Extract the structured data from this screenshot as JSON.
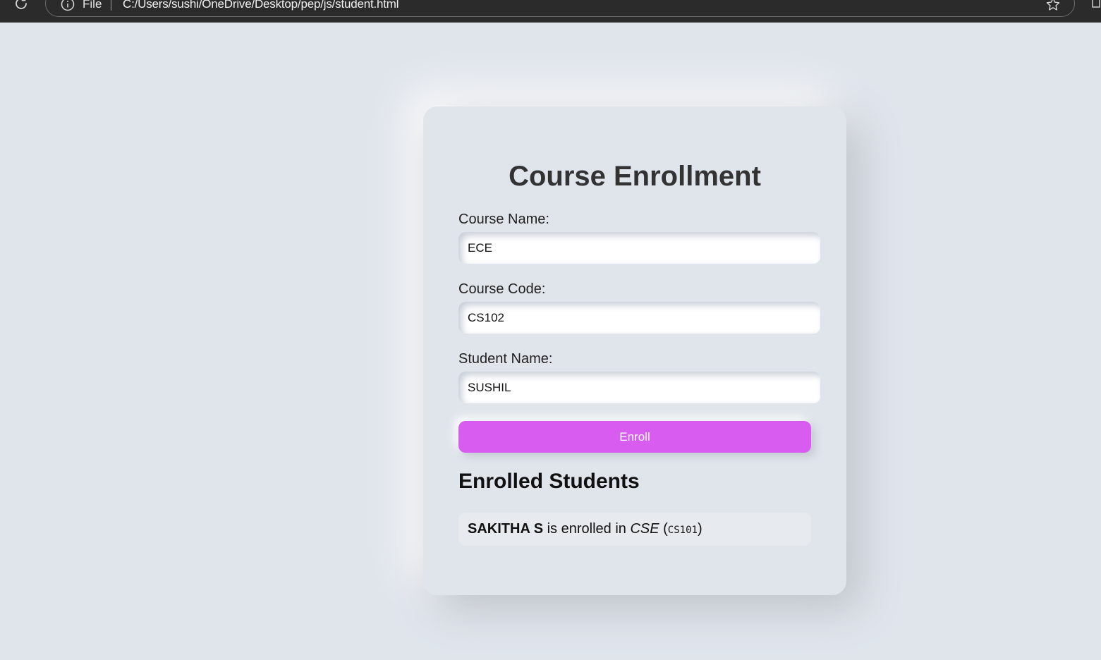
{
  "browser": {
    "scheme_label": "File",
    "url": "C:/Users/sushi/OneDrive/Desktop/pep/js/student.html",
    "icons": [
      "reload-icon",
      "info-icon",
      "star-icon",
      "edge-icon"
    ]
  },
  "form": {
    "title": "Course Enrollment",
    "course_name_label": "Course Name:",
    "course_name_value": "ECE",
    "course_code_label": "Course Code:",
    "course_code_value": "CS102",
    "student_name_label": "Student Name:",
    "student_name_value": "SUSHIL",
    "enroll_label": "Enroll"
  },
  "enrolled": {
    "heading": "Enrolled Students",
    "items": [
      {
        "student": "SAKITHA S",
        "connector": " is enrolled in ",
        "course": "CSE",
        "open_paren": " (",
        "code": "CS101",
        "close_paren": ")"
      }
    ]
  },
  "colors": {
    "background": "#e0e5ec",
    "button": "#d95cf0",
    "browser_bar": "#2b2b2b"
  }
}
